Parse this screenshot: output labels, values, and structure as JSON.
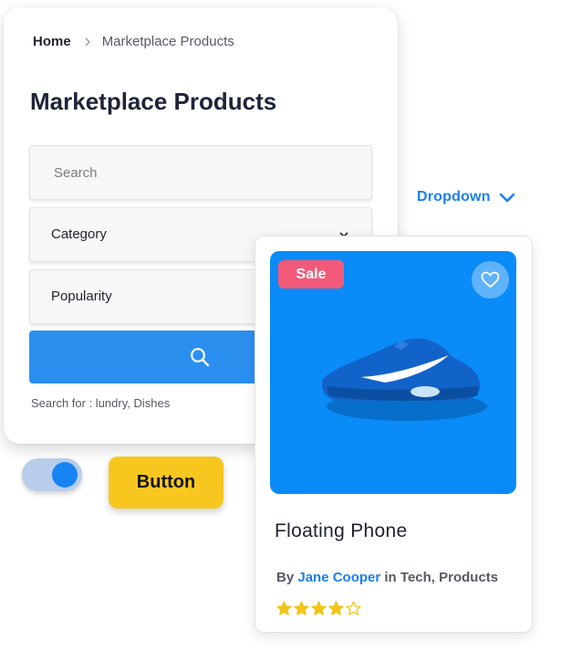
{
  "breadcrumb": {
    "home": "Home",
    "current": "Marketplace Products"
  },
  "page_title": "Marketplace Products",
  "search": {
    "placeholder": "Search"
  },
  "filters": {
    "category_label": "Category",
    "popularity_label": "Popularity"
  },
  "search_hint": "Search for : lundry, Dishes",
  "dropdown": {
    "label": "Dropdown"
  },
  "toggle": {
    "state": "on"
  },
  "button": {
    "label": "Button"
  },
  "product": {
    "badge": "Sale",
    "title": "Floating Phone",
    "by_prefix": "By",
    "author": "Jane Cooper",
    "in_text": "in",
    "categories": "Tech, Products",
    "rating": 4,
    "rating_max": 5
  },
  "colors": {
    "accent_blue": "#1a7ff0",
    "search_button": "#2b8ff0",
    "card_image_bg": "#0a8bf7",
    "sale_badge": "#f35a7a",
    "yellow_button": "#f7c720",
    "star": "#f2c418"
  },
  "icons": [
    "chevron-right-icon",
    "chevron-down-icon",
    "search-icon",
    "heart-icon",
    "star-icon",
    "star-outline-icon"
  ]
}
